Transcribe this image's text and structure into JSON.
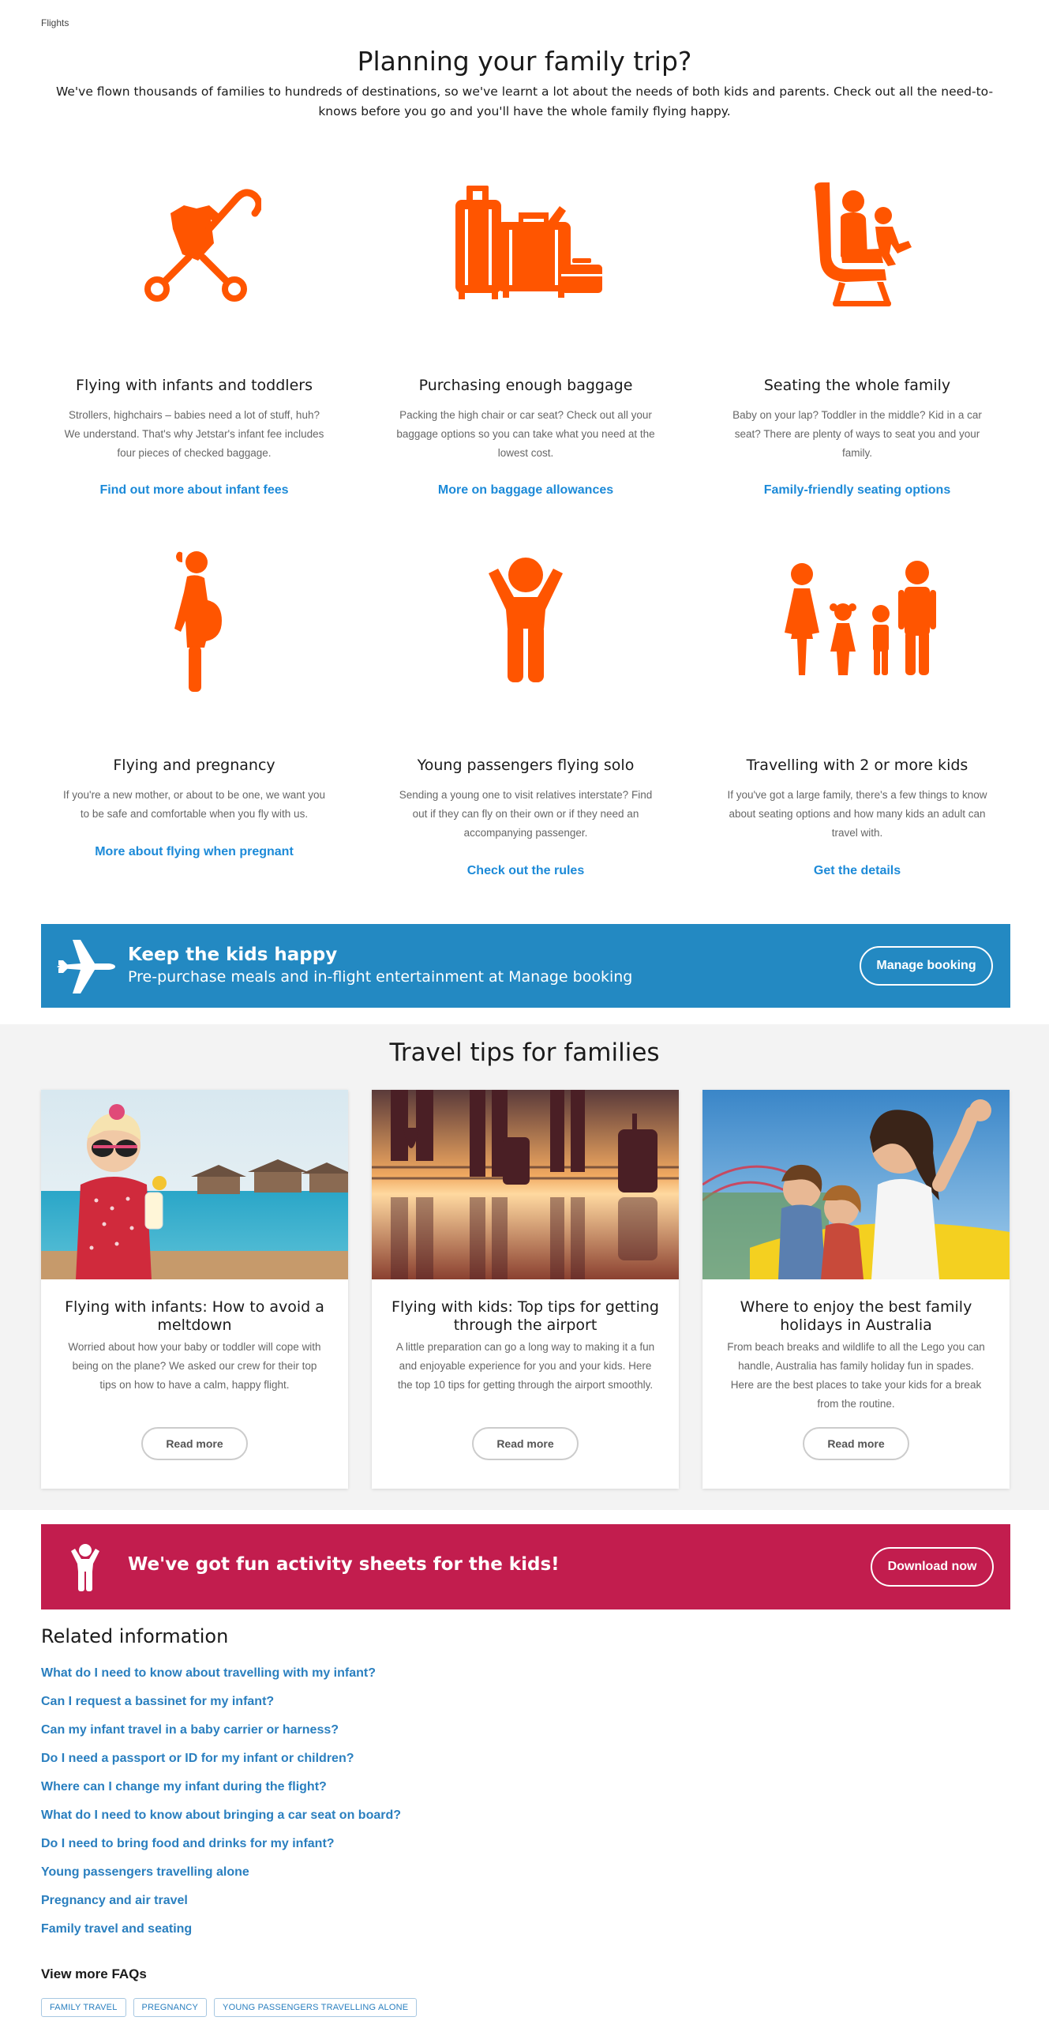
{
  "breadcrumb": "Flights",
  "header": {
    "title": "Planning your family trip?",
    "intro": "We've flown thousands of families to hundreds of destinations, so we've learnt a lot about the needs of both kids and parents. Check out all the need-to-knows before you go and you'll have the whole family flying happy."
  },
  "features": [
    {
      "icon": "stroller-icon",
      "title": "Flying with infants and toddlers",
      "text": "Strollers, highchairs – babies need a lot of stuff, huh? We understand. That's why Jetstar's infant fee includes four pieces of checked baggage.",
      "link": "Find out more about infant fees"
    },
    {
      "icon": "luggage-icon",
      "title": "Purchasing enough baggage",
      "text": "Packing the high chair or car seat? Check out all your baggage options so you can take what you need at the lowest cost.",
      "link": "More on baggage allowances"
    },
    {
      "icon": "seat-icon",
      "title": "Seating the whole family",
      "text": "Baby on your lap? Toddler in the middle? Kid in a car seat? There are plenty of ways to seat you and your family.",
      "link": "Family-friendly seating options"
    },
    {
      "icon": "pregnant-woman-icon",
      "title": "Flying and pregnancy",
      "text": "If you're a new mother, or about to be one, we want you to be safe and comfortable when you fly with us.",
      "link": "More about flying when pregnant"
    },
    {
      "icon": "child-icon",
      "title": "Young passengers flying solo",
      "text": "Sending a young one to visit relatives interstate? Find out if they can fly on their own or if they need an accompanying passenger.",
      "link": "Check out the rules"
    },
    {
      "icon": "family-icon",
      "title": "Travelling with 2 or more kids",
      "text": "If you've got a large family, there's a few things to know about seating options and how many kids an adult can travel with.",
      "link": "Get the details"
    }
  ],
  "kids_banner": {
    "title": "Keep the kids happy",
    "subtitle": "Pre-purchase meals and in-flight entertainment at Manage booking",
    "button": "Manage booking"
  },
  "tips": {
    "title": "Travel tips for families",
    "cards": [
      {
        "title": "Flying with infants: How to avoid a meltdown",
        "text": "Worried about how your baby or toddler will cope with being on the plane? We asked our crew for their top tips on how to have a calm, happy flight.",
        "button": "Read more"
      },
      {
        "title": "Flying with kids: Top tips for getting through the airport",
        "text": "A little preparation can go a long way to making it a fun and enjoyable experience for you and your kids. Here the top 10 tips for getting through the airport smoothly.",
        "button": "Read more"
      },
      {
        "title": "Where to enjoy the best family holidays in Australia",
        "text": "From beach breaks and wildlife to all the Lego you can handle, Australia has family holiday fun in spades. Here are the best places to take your kids for a break from the routine.",
        "button": "Read more"
      }
    ]
  },
  "activity_banner": {
    "title": "We've got fun activity sheets for the kids!",
    "button": "Download now"
  },
  "related": {
    "title": "Related information",
    "links": [
      "What do I need to know about travelling with my infant?",
      "Can I request a bassinet for my infant?",
      "Can my infant travel in a baby carrier or harness?",
      "Do I need a passport or ID for my infant or children?",
      "Where can I change my infant during the flight?",
      "What do I need to know about bringing a car seat on board?",
      "Do I need to bring food and drinks for my infant?",
      "Young passengers travelling alone",
      "Pregnancy and air travel",
      "Family travel and seating"
    ]
  },
  "faqs": {
    "title": "View more FAQs",
    "tags": [
      "FAMILY TRAVEL",
      "PREGNANCY",
      "YOUNG PASSENGERS TRAVELLING ALONE"
    ]
  },
  "colors": {
    "accent_orange": "#ff5500",
    "link_blue": "#1c8ad8",
    "banner_blue": "#2389c2",
    "banner_pink": "#c21d4e"
  }
}
